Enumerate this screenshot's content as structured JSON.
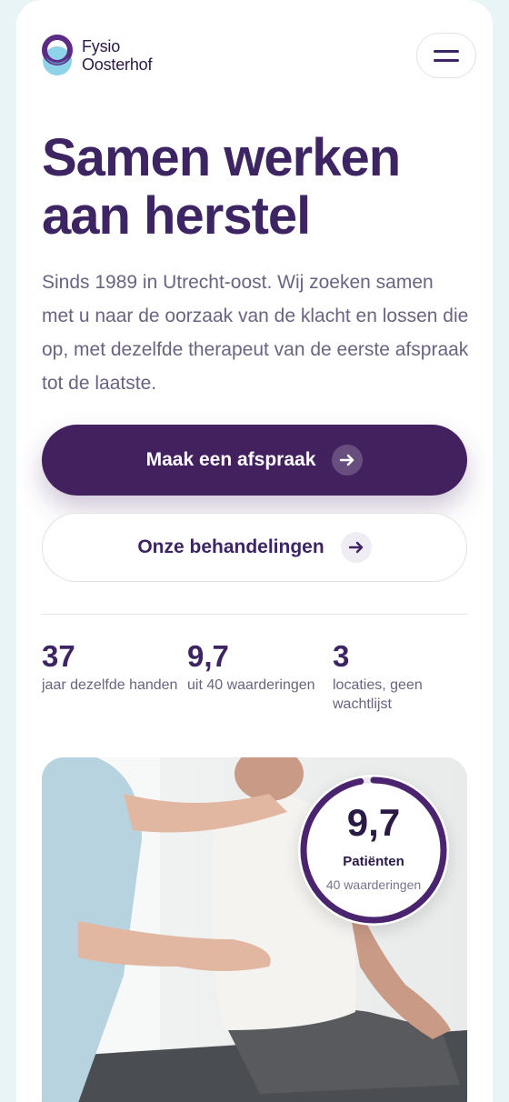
{
  "brand": {
    "line1": "Fysio",
    "line2": "Oosterhof"
  },
  "header": {
    "menu_icon": "hamburger-menu-icon"
  },
  "hero": {
    "title": "Samen werken aan herstel",
    "text": "Sinds 1989 in Utrecht-oost. Wij zoeken samen met u naar de oorzaak van de klacht en lossen die op, met dezelfde therapeut van de eerste afspraak tot de laatste."
  },
  "actions": {
    "primary_label": "Maak een afspraak",
    "secondary_label": "Onze behandelingen",
    "arrow_icon": "arrow-right-icon"
  },
  "stats": [
    {
      "value": "37",
      "label": "jaar dezelfde handen"
    },
    {
      "value": "9,7",
      "label": "uit 40 waarderingen"
    },
    {
      "value": "3",
      "label": "locaties, geen wachtlijst"
    }
  ],
  "rating": {
    "value": "9,7",
    "label": "Patiënten",
    "sub": "40 waarderingen",
    "fraction": 0.97
  },
  "colors": {
    "brand_purple": "#43215f",
    "text_purple": "#3d2563",
    "muted_text": "#6b6380",
    "logo_teal": "#8fd3e8",
    "page_background": "#e8f4f5"
  }
}
